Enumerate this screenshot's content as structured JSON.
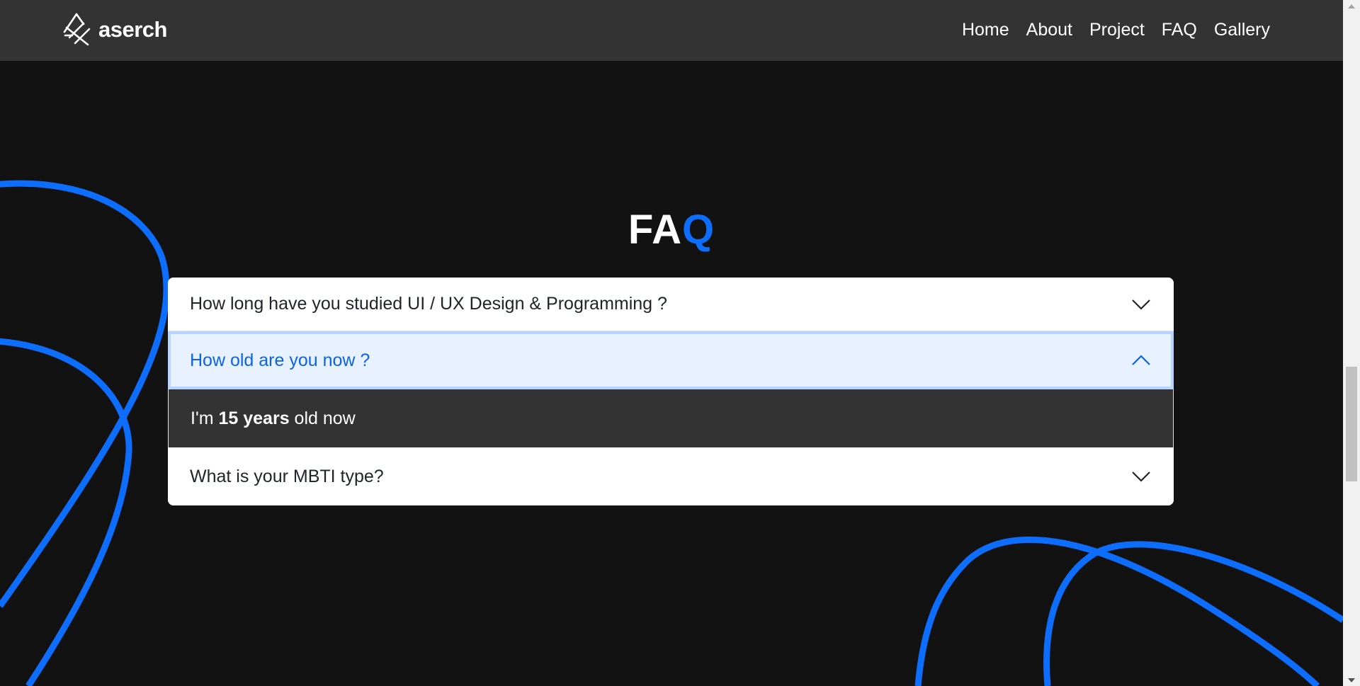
{
  "brand": {
    "name": "aserch",
    "icon": "crossed-lines-logo-icon"
  },
  "nav": [
    "Home",
    "About",
    "Project",
    "FAQ",
    "Gallery"
  ],
  "faq": {
    "title_part1": "FA",
    "title_part2": "Q",
    "items": [
      {
        "question": "How long have you studied UI / UX Design & Programming ?",
        "expanded": false
      },
      {
        "question": "How old are you now ?",
        "expanded": true,
        "answer": {
          "prefix": "I'm ",
          "bold": "15 years",
          "suffix": " old now"
        }
      },
      {
        "question": "What is your MBTI type?",
        "expanded": false
      }
    ]
  },
  "colors": {
    "background": "#121212",
    "topbar": "#333333",
    "accent": "#0d6efd",
    "active_header_bg": "#e7f1ff",
    "active_header_text": "#0c63e4",
    "answer_bg": "#333333"
  }
}
